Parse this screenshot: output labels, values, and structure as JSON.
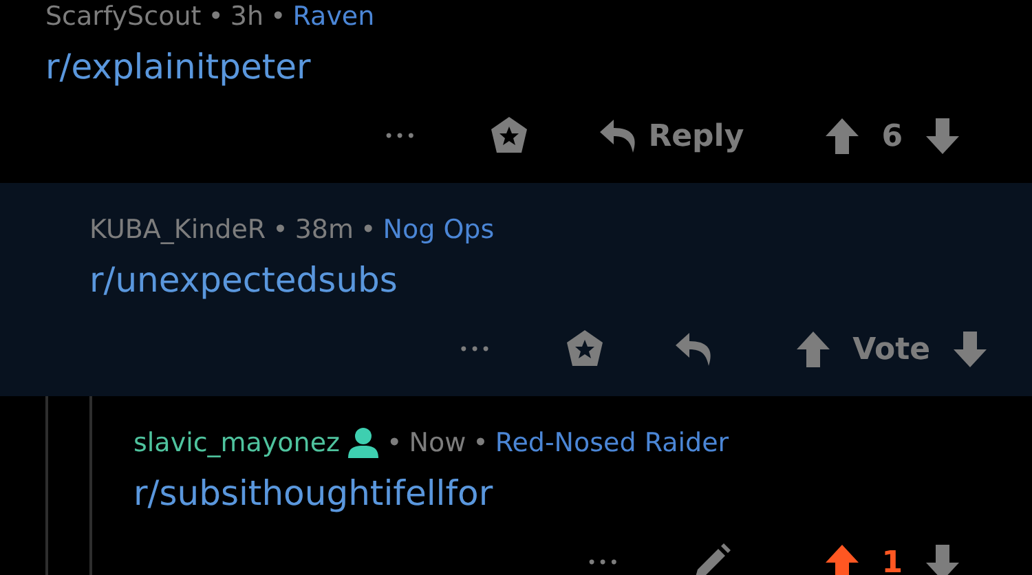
{
  "comments": [
    {
      "author": "ScarfyScout",
      "is_self": false,
      "time": "3h",
      "separator": "•",
      "flair": "Raven",
      "body": "r/explainitpeter",
      "highlighted": false,
      "kind": "other",
      "more": "•••",
      "reply_label": "Reply",
      "score": "6",
      "upvoted": false,
      "children": [
        {
          "author": "KUBA_KindeR",
          "is_self": false,
          "time": "38m",
          "separator": "•",
          "flair": "Nog Ops",
          "body": "r/unexpectedsubs",
          "highlighted": true,
          "kind": "other",
          "more": "•••",
          "score": "Vote",
          "upvoted": false,
          "children": [
            {
              "author": "slavic_mayonez",
              "is_self": true,
              "time": "Now",
              "separator": "•",
              "flair": "Red-Nosed Raider",
              "body": "r/subsithoughtifellfor",
              "highlighted": false,
              "kind": "own",
              "more": "•••",
              "score": "1",
              "upvoted": true
            }
          ]
        }
      ]
    }
  ]
}
